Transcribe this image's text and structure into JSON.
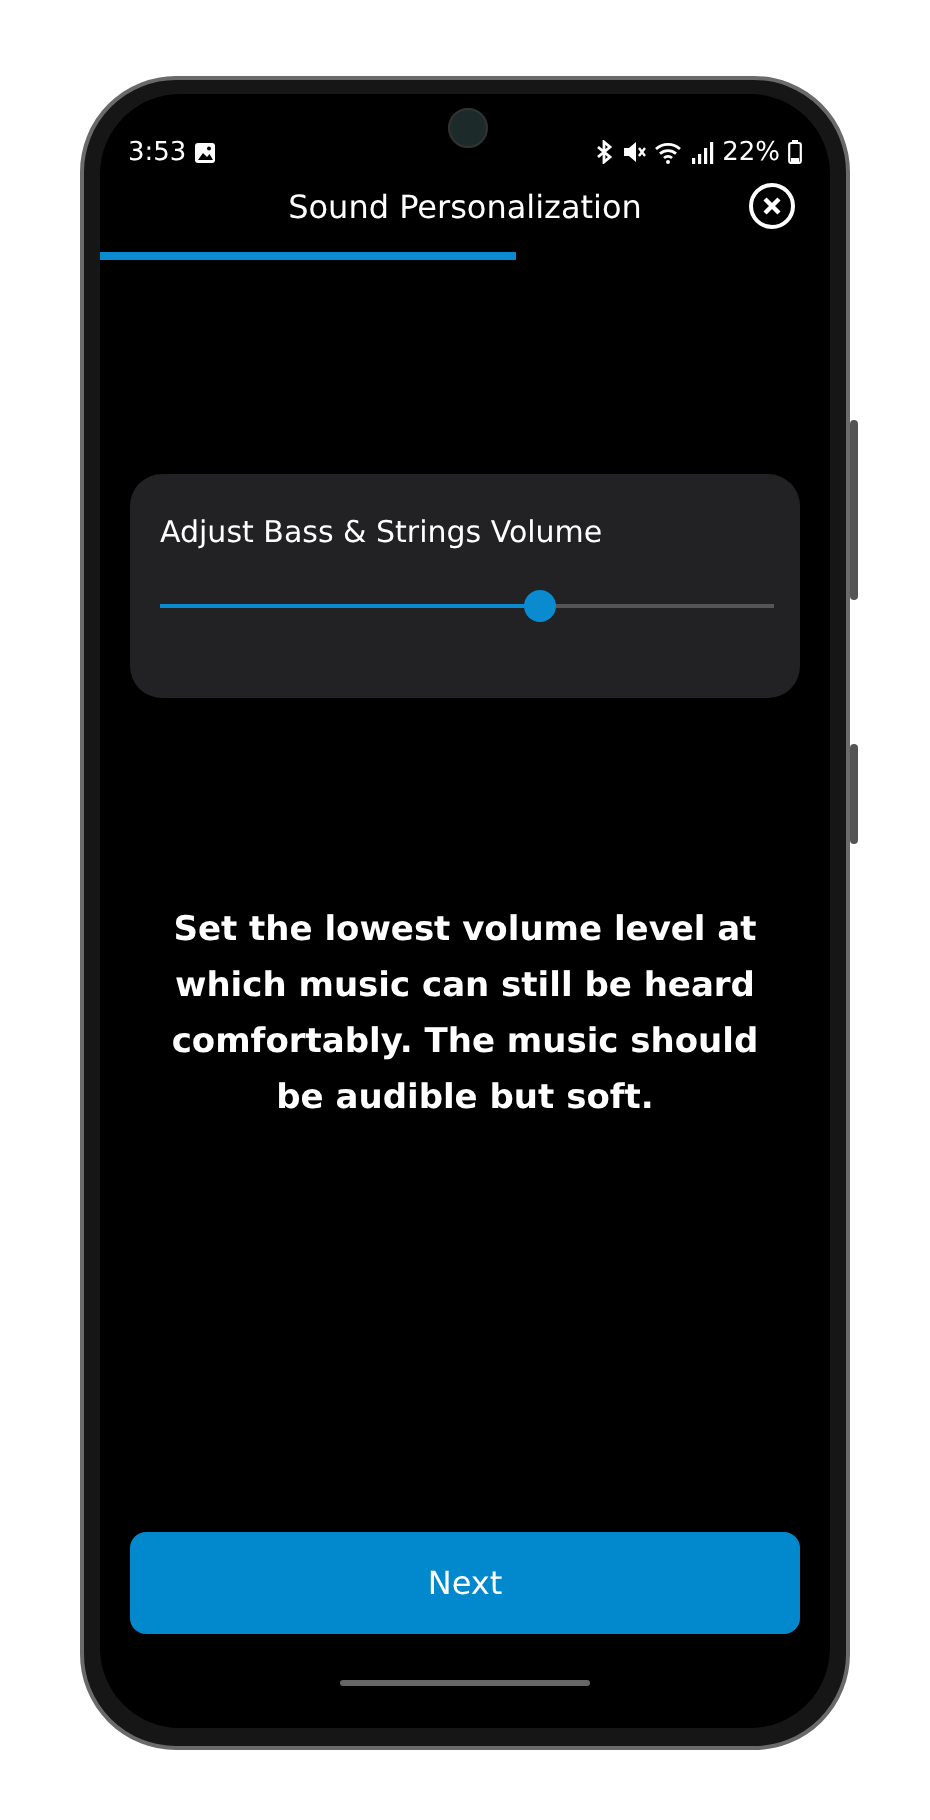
{
  "status_bar": {
    "time": "3:53",
    "battery": "22%"
  },
  "header": {
    "title": "Sound Personalization"
  },
  "card": {
    "label": "Adjust Bass & Strings Volume",
    "slider": {
      "level": 0.62
    }
  },
  "instruction": "Set the lowest volume level at which music can still be heard comfortably. The music should be audible but soft.",
  "next_button": {
    "label": "Next"
  }
}
